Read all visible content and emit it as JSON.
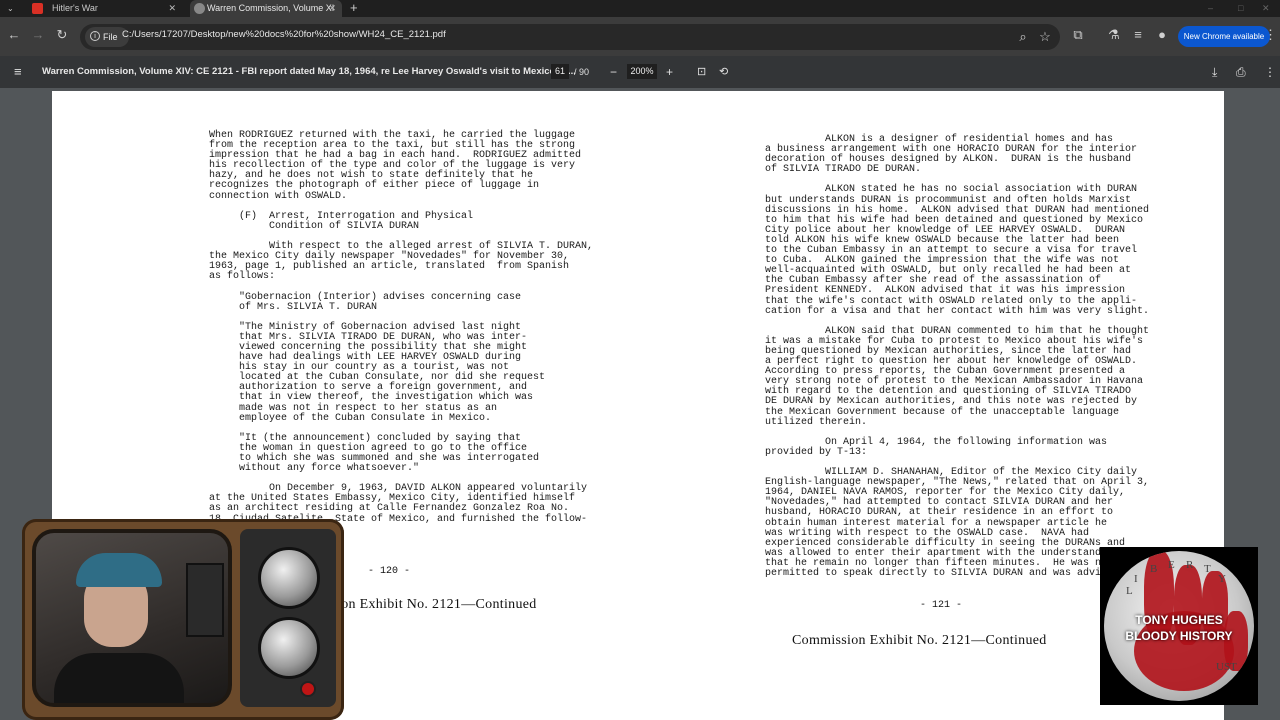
{
  "tabs": [
    {
      "title": "Hitler's War",
      "favicon_color": "#d93025"
    },
    {
      "title": "Warren Commission, Volume XI"
    }
  ],
  "toolbar": {
    "chip_label": "File",
    "url": "C:/Users/17207/Desktop/new%20docs%20for%20show/WH24_CE_2121.pdf",
    "new_chrome_label": "New Chrome available"
  },
  "pdf": {
    "title": "Warren Commission, Volume XIV: CE 2121 - FBI report dated May 18, 1964, re Lee Harvey Oswald's visit to Mexico (C...",
    "current_page": "61",
    "total_pages": "/ 90",
    "zoom": "200%"
  },
  "document": {
    "left_column": "When RODRIGUEZ returned with the taxi, he carried the luggage\nfrom the reception area to the taxi, but still has the strong\nimpression that he had a bag in each hand.  RODRIGUEZ admitted\nhis recollection of the type and color of the luggage is very\nhazy, and he does not wish to state definitely that he\nrecognizes the photograph of either piece of luggage in\nconnection with OSWALD.\n\n     (F)  Arrest, Interrogation and Physical\n          Condition of SILVIA DURAN\n\n          With respect to the alleged arrest of SILVIA T. DURAN,\nthe Mexico City daily newspaper \"Novedades\" for November 30,\n1963, page 1, published an article, translated  from Spanish\nas follows:\n\n     \"Gobernacion (Interior) advises concerning case\n     of Mrs. SILVIA T. DURAN\n\n     \"The Ministry of Gobernacion advised last night\n     that Mrs. SILVIA TIRADO DE DURAN, who was inter-\n     viewed concerning the possibility that she might\n     have had dealings with LEE HARVEY OSWALD during\n     his stay in our country as a tourist, was not\n     located at the Cuban Consulate, nor did she request\n     authorization to serve a foreign government, and\n     that in view thereof, the investigation which was\n     made was not in respect to her status as an\n     employee of the Cuban Consulate in Mexico.\n\n     \"It (the announcement) concluded by saying that\n     the woman in question agreed to go to the office\n     to which she was summoned and she was interrogated\n     without any force whatsoever.\"\n\n          On December 9, 1963, DAVID ALKON appeared voluntarily\nat the United States Embassy, Mexico City, identified himself\nas an architect residing at Calle Fernandez Gonzalez Roa No.\n18, Ciudad Satelite, State of Mexico, and furnished the follow-",
    "left_page_number": "- 120 -",
    "left_exhibit": "Commission Exhibit No. 2121—Continued",
    "right_column": "          ALKON is a designer of residential homes and has\na business arrangement with one HORACIO DURAN for the interior\ndecoration of houses designed by ALKON.  DURAN is the husband\nof SILVIA TIRADO DE DURAN.\n\n          ALKON stated he has no social association with DURAN\nbut understands DURAN is procommunist and often holds Marxist\ndiscussions in his home.  ALKON advised that DURAN had mentioned\nto him that his wife had been detained and questioned by Mexico\nCity police about her knowledge of LEE HARVEY OSWALD.  DURAN\ntold ALKON his wife knew OSWALD because the latter had been\nto the Cuban Embassy in an attempt to secure a visa for travel\nto Cuba.  ALKON gained the impression that the wife was not\nwell-acquainted with OSWALD, but only recalled he had been at\nthe Cuban Embassy after she read of the assassination of\nPresident KENNEDY.  ALKON advised that it was his impression\nthat the wife's contact with OSWALD related only to the appli-\ncation for a visa and that her contact with him was very slight.\n\n          ALKON said that DURAN commented to him that he thought\nit was a mistake for Cuba to protest to Mexico about his wife's\nbeing questioned by Mexican authorities, since the latter had\na perfect right to question her about her knowledge of OSWALD.\nAccording to press reports, the Cuban Government presented a\nvery strong note of protest to the Mexican Ambassador in Havana\nwith regard to the detention and questioning of SILVIA TIRADO\nDE DURAN by Mexican authorities, and this note was rejected by\nthe Mexican Government because of the unacceptable language\nutilized therein.\n\n          On April 4, 1964, the following information was\nprovided by T-13:\n\n          WILLIAM D. SHANAHAN, Editor of the Mexico City daily\nEnglish-language newspaper, \"The News,\" related that on April 3,\n1964, DANIEL NAVA RAMOS, reporter for the Mexico City daily,\n\"Novedades,\" had attempted to contact SILVIA DURAN and her\nhusband, HORACIO DURAN, at their residence in an effort to\nobtain human interest material for a newspaper article he\nwas writing with respect to the OSWALD case.  NAVA had\nexperienced considerable difficulty in seeing the DURANs and\nwas allowed to enter their apartment with the understanding\nthat he remain no longer than fifteen minutes.  He was not\npermitted to speak directly to SILVIA DURAN and was advised",
    "right_page_number": "- 121 -",
    "right_exhibit": "Commission Exhibit No. 2121—Continued"
  },
  "overlay": {
    "coin_line1": "TONY HUGHES",
    "coin_line2": "BLOODY HISTORY",
    "coin_letters": [
      "L",
      "I",
      "B",
      "E",
      "R",
      "T",
      "Y"
    ],
    "coin_small": "UST",
    "accent_red": "#b0121a"
  }
}
